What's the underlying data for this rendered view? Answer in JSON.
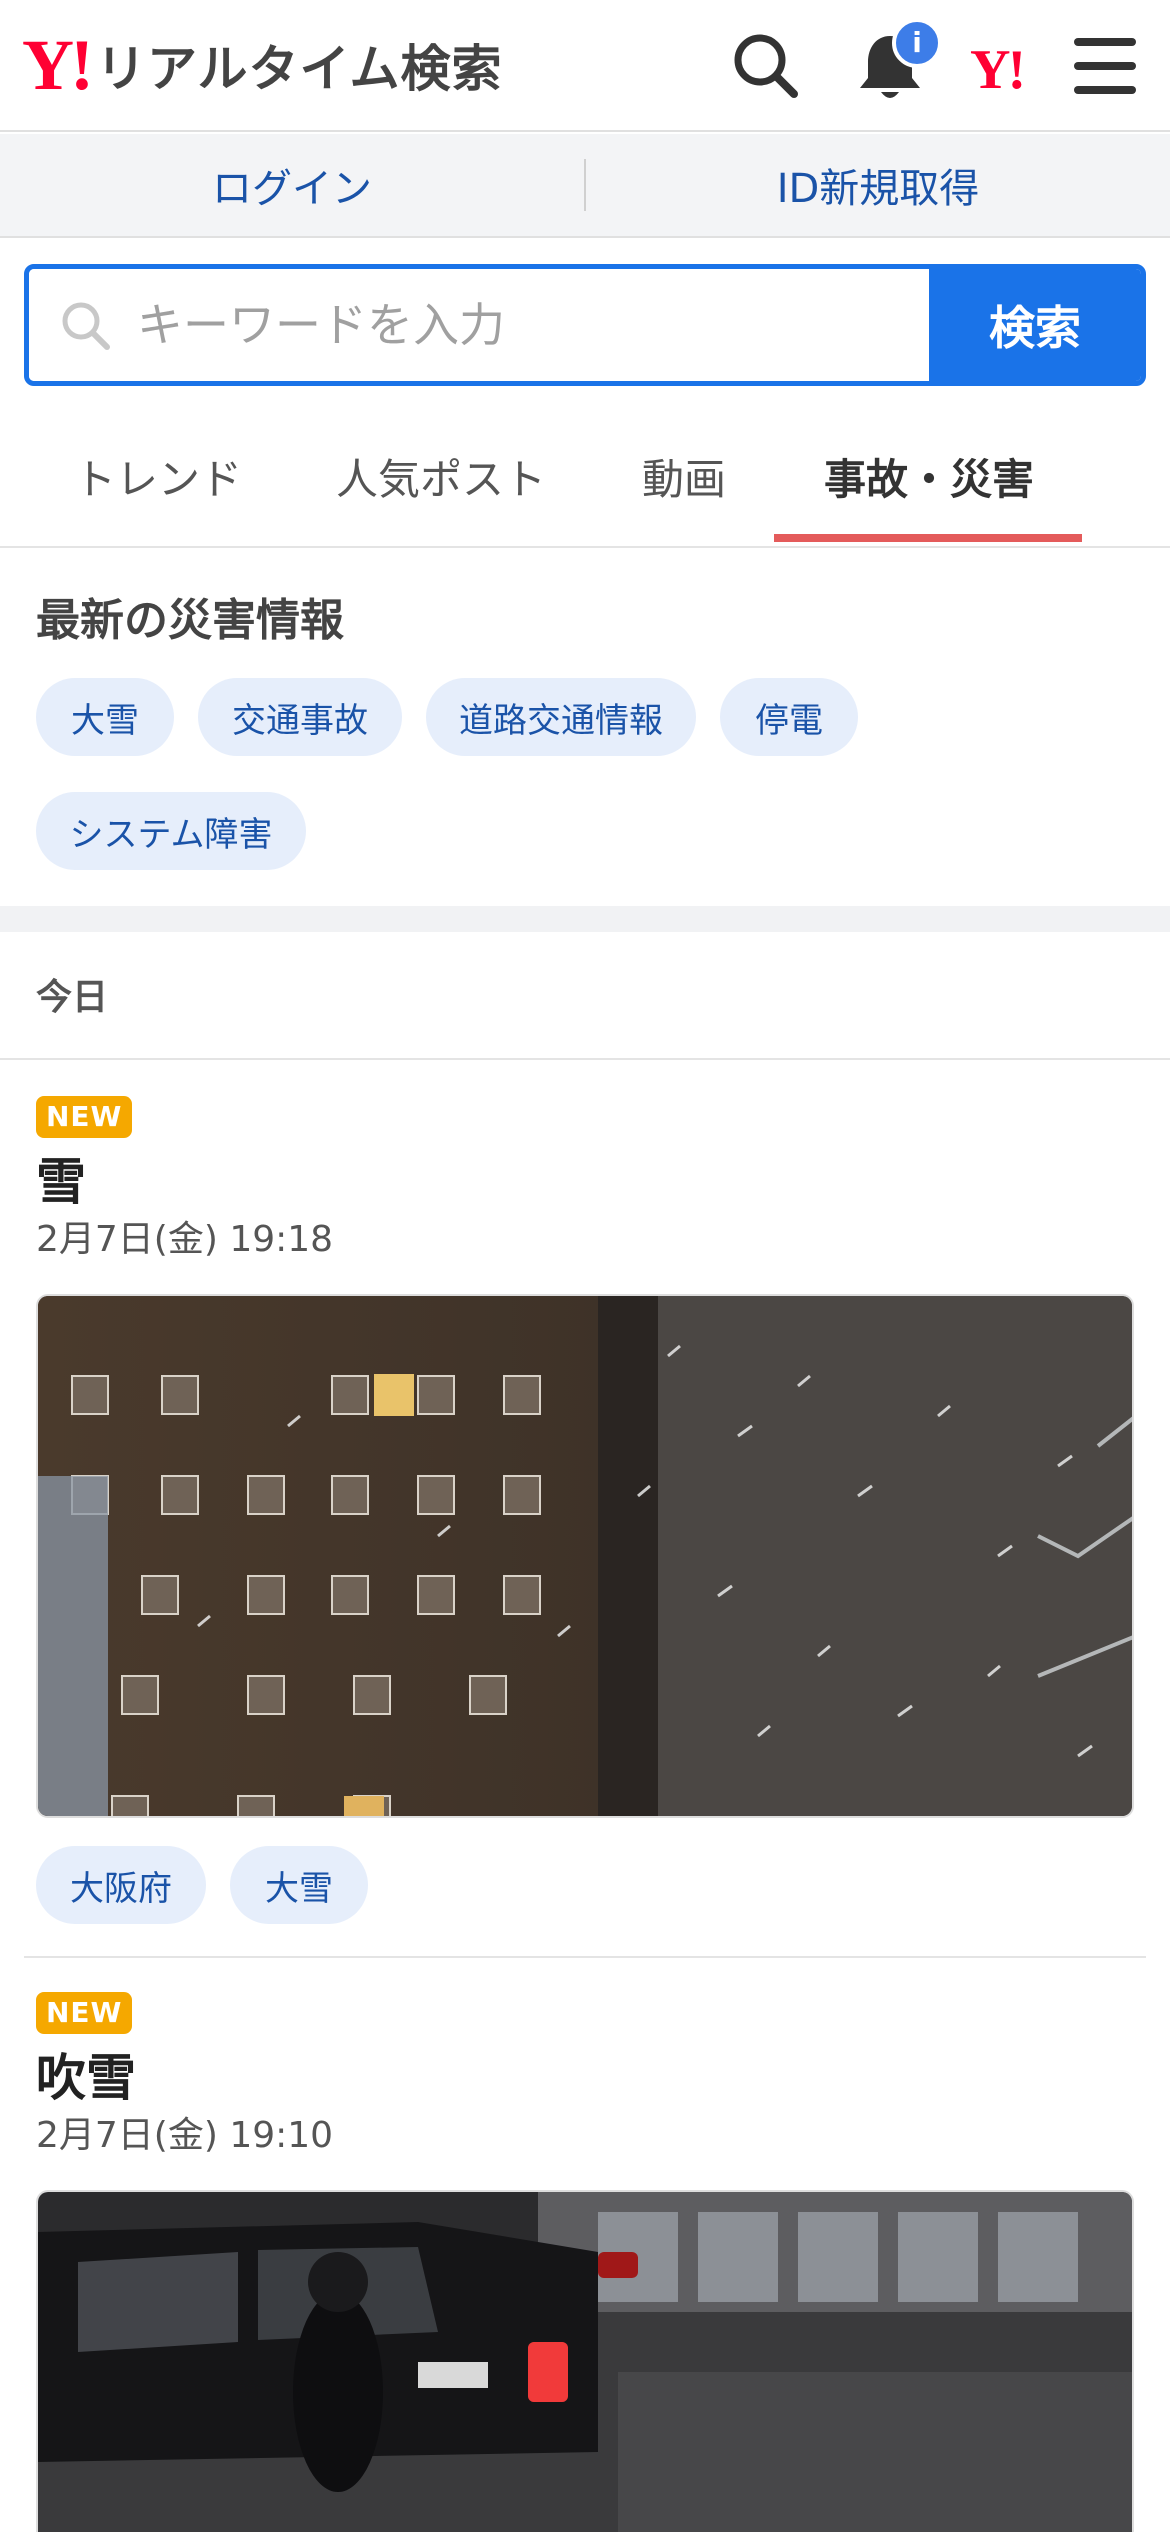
{
  "header": {
    "logo_mark": "Y!",
    "logo_text": "リアルタイム検索",
    "notification_badge": "i",
    "yahoo_mini_logo": "Y!",
    "icons": [
      "search-icon",
      "bell-icon",
      "yahoo-logo-icon",
      "menu-icon"
    ]
  },
  "login_bar": {
    "login": "ログイン",
    "signup": "ID新規取得"
  },
  "search": {
    "placeholder": "キーワードを入力",
    "button": "検索"
  },
  "tabs": [
    {
      "label": "トレンド"
    },
    {
      "label": "人気ポスト"
    },
    {
      "label": "動画"
    },
    {
      "label": "事故・災害",
      "active": true
    }
  ],
  "disaster": {
    "title": "最新の災害情報",
    "chips": [
      "大雪",
      "交通事故",
      "道路交通情報",
      "停電",
      "システム障害"
    ]
  },
  "day_label": "今日",
  "posts": [
    {
      "badge": "NEW",
      "title": "雪",
      "time": "2月7日(金) 19:18",
      "tags": [
        "大阪府",
        "大雪"
      ]
    },
    {
      "badge": "NEW",
      "title": "吹雪",
      "time": "2月7日(金) 19:10"
    }
  ],
  "colors": {
    "brand_red": "#ff0033",
    "accent_blue": "#1a73e8",
    "link_blue": "#1a53a8",
    "chip_bg": "#e6eefb",
    "new_badge": "#f5a800",
    "tab_underline": "#e45b5b"
  }
}
